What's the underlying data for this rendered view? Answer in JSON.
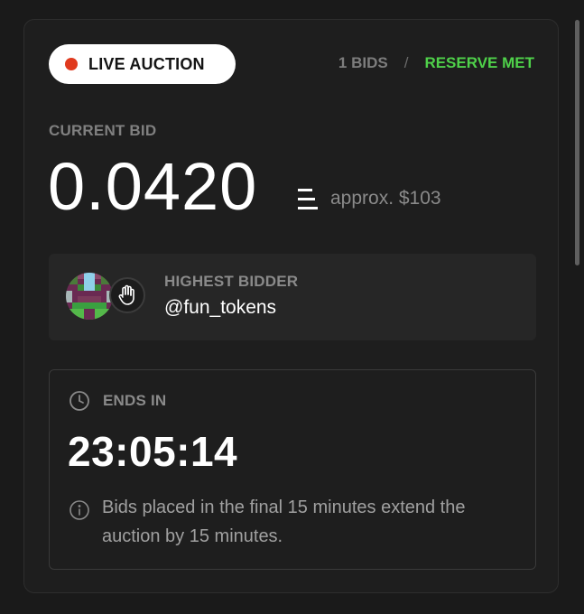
{
  "status": {
    "live_label": "LIVE AUCTION",
    "bids_count": "1 BIDS",
    "separator": "/",
    "reserve_status": "RESERVE MET"
  },
  "current_bid": {
    "label": "CURRENT BID",
    "amount": "0.0420",
    "currency_icon": "eth-icon",
    "approx_usd": "approx. $103"
  },
  "highest_bidder": {
    "label": "HIGHEST BIDDER",
    "username": "@fun_tokens",
    "avatar_icon": "pixel-avatar",
    "badge_icon": "hand-icon"
  },
  "ends_in": {
    "label": "ENDS IN",
    "countdown": "23:05:14",
    "info_text": "Bids placed in the final 15 minutes extend the auction by 15 minutes.",
    "clock_icon": "clock-icon",
    "info_icon": "info-icon"
  },
  "colors": {
    "background": "#1a1a1a",
    "card": "#1e1e1e",
    "live_dot": "#e03a1e",
    "reserve_green": "#4fd14a",
    "muted_text": "#808080"
  }
}
